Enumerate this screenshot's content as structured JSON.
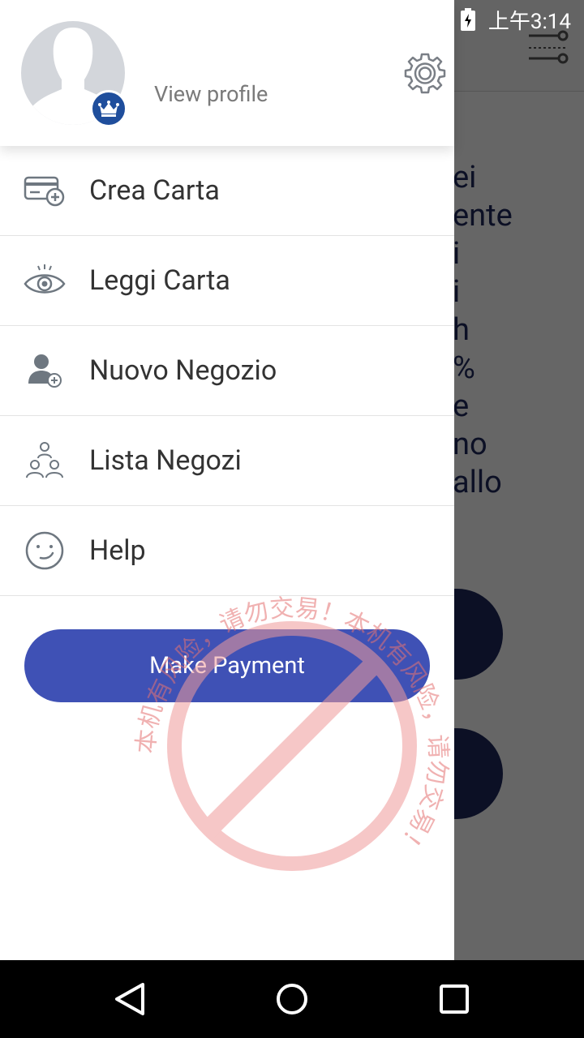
{
  "status_bar": {
    "time": "上午3:14"
  },
  "background_app": {
    "text_lines": [
      "ei",
      "ente",
      "i",
      "i",
      "h",
      "%",
      "e",
      "no",
      "allo"
    ]
  },
  "drawer": {
    "view_profile": "View profile",
    "menu": [
      {
        "label": "Crea Carta",
        "icon": "add-card-icon"
      },
      {
        "label": "Leggi Carta",
        "icon": "eye-icon"
      },
      {
        "label": "Nuovo Negozio",
        "icon": "add-user-icon"
      },
      {
        "label": "Lista Negozi",
        "icon": "group-icon"
      },
      {
        "label": "Help",
        "icon": "smiley-icon"
      }
    ],
    "make_payment": "Make Payment"
  },
  "watermark": {
    "text": "本机有风险，请勿交易！本机有风险，请勿交易！"
  },
  "colors": {
    "accent": "#3f51b5",
    "crown_badge": "#1f4e9c",
    "background_text": "#1f2a5c",
    "watermark": "#e53935"
  }
}
